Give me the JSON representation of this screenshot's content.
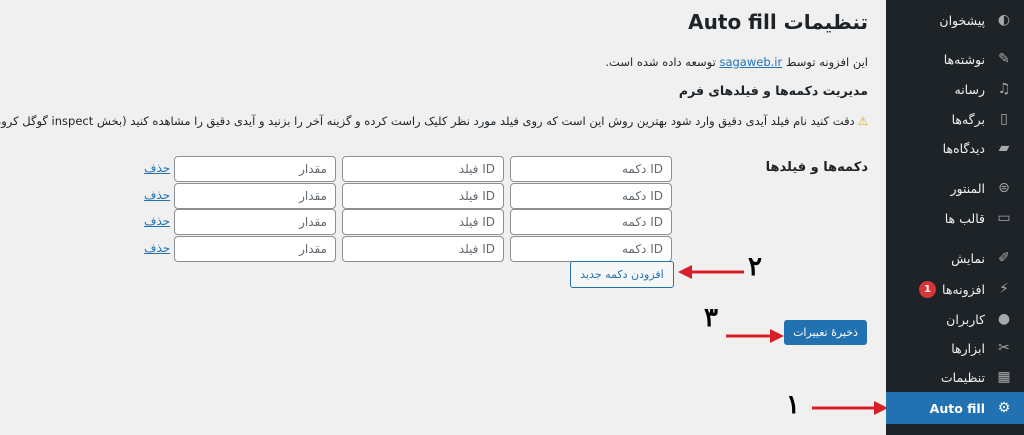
{
  "sidebar": {
    "items": [
      {
        "label": "پیشخوان",
        "icon": "dashboard-icon"
      },
      {
        "label": "نوشته‌ها",
        "icon": "pin-icon"
      },
      {
        "label": "رسانه",
        "icon": "media-icon"
      },
      {
        "label": "برگه‌ها",
        "icon": "pages-icon"
      },
      {
        "label": "دیدگاه‌ها",
        "icon": "comments-icon"
      },
      {
        "label": "المنتور",
        "icon": "elementor-icon"
      },
      {
        "label": "قالب ها",
        "icon": "folder-icon"
      },
      {
        "label": "نمایش",
        "icon": "appearance-icon"
      },
      {
        "label": "افزونه‌ها",
        "icon": "plugins-icon",
        "badge": "1"
      },
      {
        "label": "کاربران",
        "icon": "users-icon"
      },
      {
        "label": "ابزارها",
        "icon": "tools-icon"
      },
      {
        "label": "تنظیمات",
        "icon": "settings-icon"
      },
      {
        "label": "Auto fill",
        "icon": "gear-icon",
        "active": true
      }
    ]
  },
  "main": {
    "title": "تنظیمات Auto fill",
    "credit_before": "این افزونه توسط",
    "credit_link": "sagaweb.ir",
    "credit_after": "توسعه داده شده است.",
    "section_title": "مدیریت دکمه‌ها و فیلدهای فرم",
    "notice": "دقت کنید نام فیلد آیدی دقیق وارد شود بهترین روش این است که روی فیلد مورد نظر کلیک راست کرده و گزینه آخر را بزنید و آیدی دقیق را مشاهده کنید (بخش inspect گوگل کروم)",
    "fields_label": "دکمه‌ها و فیلدها",
    "placeholders": {
      "button_id": "ID دکمه",
      "field_id": "ID فیلد",
      "value": "مقدار"
    },
    "delete_label": "حذف",
    "add_button_label": "افزودن دکمه جدید",
    "save_button_label": "ذخیرهٔ تغییرات"
  },
  "annotations": {
    "one": "۱",
    "two": "۲",
    "three": "۳",
    "arrow_color": "#d61f26"
  },
  "colors": {
    "sidebar_bg": "#1d2327",
    "accent": "#2271b1",
    "page_bg": "#f0f0f1",
    "badge": "#d63638"
  }
}
